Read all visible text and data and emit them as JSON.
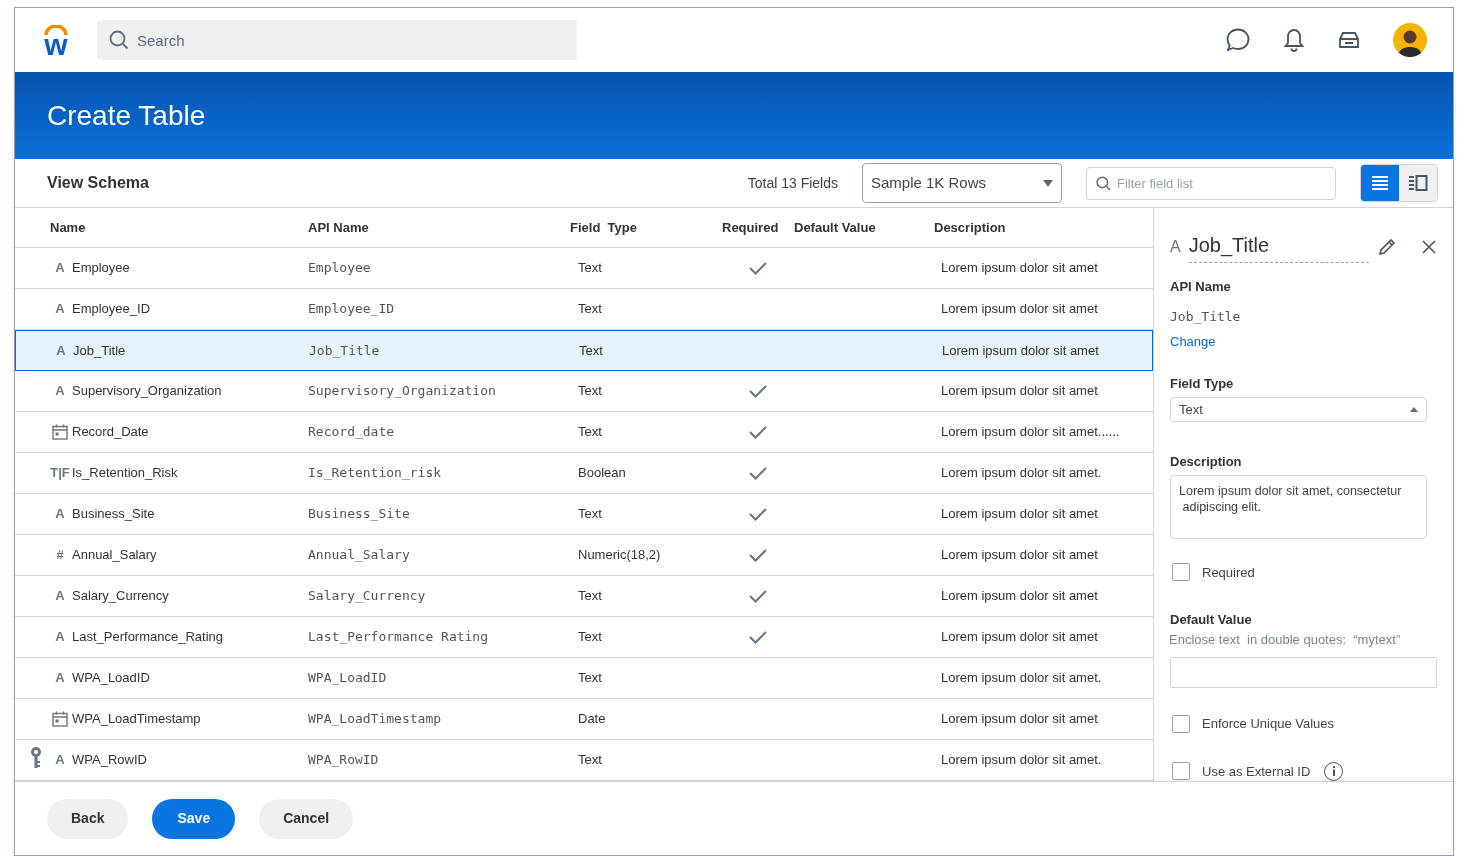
{
  "topbar": {
    "logo_text": "w",
    "search": {
      "placeholder": "Search"
    }
  },
  "header": {
    "title": "Create Table"
  },
  "toolbar": {
    "title": "View Schema",
    "total": "Total 13 Fields",
    "sample": "Sample 1K Rows",
    "filter": {
      "placeholder": "Filter field list"
    },
    "views": [
      {
        "kind": "list",
        "selected": true
      },
      {
        "kind": "detail",
        "selected": false
      }
    ]
  },
  "table": {
    "columns": [
      "Name",
      "API Name",
      "Field  Type",
      "Required",
      "Default Value",
      "Description"
    ],
    "rows": [
      {
        "kind": "glyph",
        "glyph": "A",
        "key": false,
        "name": "Employee",
        "api_name": "Employee",
        "field_type": "Text",
        "required": true,
        "description": "Lorem ipsum dolor sit amet",
        "selected": false
      },
      {
        "kind": "glyph",
        "glyph": "A",
        "key": false,
        "name": "Employee_ID",
        "api_name": "Employee_ID",
        "field_type": "Text",
        "required": false,
        "description": "Lorem ipsum dolor sit amet",
        "selected": false
      },
      {
        "kind": "glyph",
        "glyph": "A",
        "key": false,
        "name": "Job_Title",
        "api_name": "Job_Title",
        "field_type": "Text",
        "required": false,
        "description": "Lorem ipsum dolor sit amet",
        "selected": true
      },
      {
        "kind": "glyph",
        "glyph": "A",
        "key": false,
        "name": "Supervisory_Organization",
        "api_name": "Supervisory_Organization",
        "field_type": "Text",
        "required": true,
        "description": "Lorem ipsum dolor sit amet",
        "selected": false
      },
      {
        "kind": "date",
        "key": false,
        "name": "Record_Date",
        "api_name": "Record_date",
        "field_type": "Text",
        "required": true,
        "description": "Lorem ipsum dolor sit amet......",
        "selected": false
      },
      {
        "kind": "glyph",
        "glyph": "T|F",
        "key": false,
        "name": "Is_Retention_Risk",
        "api_name": "Is_Retention_risk",
        "field_type": "Boolean",
        "required": true,
        "description": "Lorem ipsum dolor sit amet.",
        "selected": false
      },
      {
        "kind": "glyph",
        "glyph": "A",
        "key": false,
        "name": "Business_Site",
        "api_name": "Business_Site",
        "field_type": "Text",
        "required": true,
        "description": "Lorem ipsum dolor sit amet",
        "selected": false
      },
      {
        "kind": "glyph",
        "glyph": "#",
        "key": false,
        "name": "Annual_Salary",
        "api_name": "Annual_Salary",
        "field_type": "Numeric(18,2)",
        "required": true,
        "description": "Lorem ipsum dolor sit amet",
        "selected": false
      },
      {
        "kind": "glyph",
        "glyph": "A",
        "key": false,
        "name": "Salary_Currency",
        "api_name": "Salary_Currency",
        "field_type": "Text",
        "required": true,
        "description": "Lorem ipsum dolor sit amet",
        "selected": false
      },
      {
        "kind": "glyph",
        "glyph": "A",
        "key": false,
        "name": "Last_Performance_Rating",
        "api_name": "Last_Performance Rating",
        "field_type": "Text",
        "required": true,
        "description": "Lorem ipsum dolor sit amet",
        "selected": false
      },
      {
        "kind": "glyph",
        "glyph": "A",
        "key": false,
        "name": "WPA_LoadID",
        "api_name": "WPA_LoadID",
        "field_type": "Text",
        "required": false,
        "description": "Lorem ipsum dolor sit amet.",
        "selected": false
      },
      {
        "kind": "date",
        "key": false,
        "name": "WPA_LoadTimestamp",
        "api_name": "WPA_LoadTimestamp",
        "field_type": "Date",
        "required": false,
        "description": "Lorem ipsum dolor sit amet",
        "selected": false
      },
      {
        "kind": "glyph",
        "glyph": "A",
        "key": true,
        "name": "WPA_RowID",
        "api_name": "WPA_RowID",
        "field_type": "Text",
        "required": false,
        "description": "Lorem ipsum dolor sit amet.",
        "selected": false
      }
    ]
  },
  "panel": {
    "glyph": "A",
    "title": "Job_Title",
    "api_label": "API Name",
    "api_value": "Job_Title",
    "change_link": "Change",
    "field_type_label": "Field Type",
    "field_type_value": "Text",
    "description_label": "Description",
    "description_value": "Lorem ipsum dolor sit amet, consectetur\n adipiscing elit.",
    "required": {
      "label": "Required",
      "checked": false
    },
    "default_label": "Default Value",
    "default_hint": "Enclose text  in double quotes:  “mytext”",
    "options": [
      {
        "kind": "plain",
        "label": "Enforce Unique Values",
        "checked": false
      },
      {
        "kind": "with_info",
        "label": "Use as External ID",
        "checked": false
      }
    ]
  },
  "footer": {
    "buttons": [
      {
        "label": "Back",
        "primary": false
      },
      {
        "label": "Save",
        "primary": true
      },
      {
        "label": "Cancel",
        "primary": false
      }
    ]
  }
}
